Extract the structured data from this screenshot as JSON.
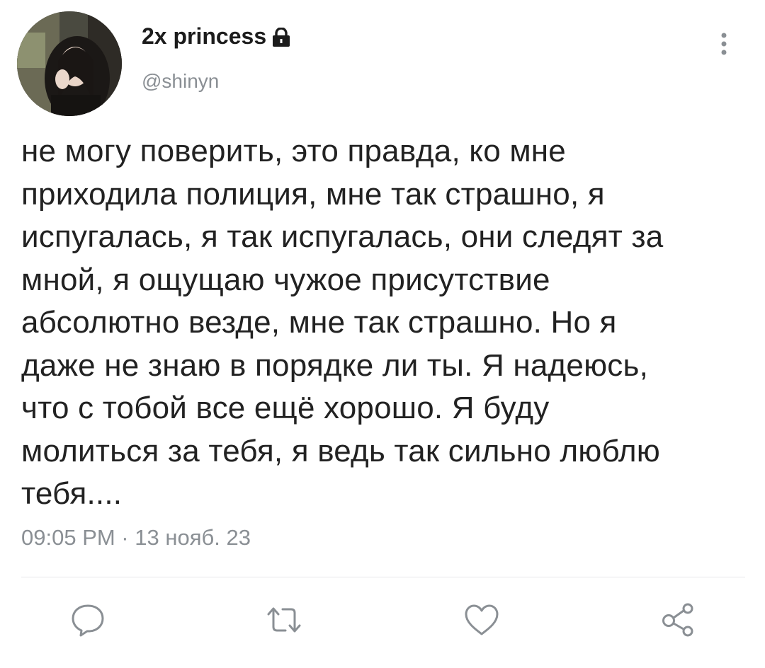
{
  "user": {
    "display_name": "2x princess",
    "handle": "@shinyn",
    "protected_icon": "lock-icon",
    "avatar": "profile-photo"
  },
  "tweet": {
    "text": "не могу поверить, это правда, ко мне\nприходила полиция, мне так страшно, я\nиспугалась, я так испугалась, они следят за\nмной, я ощущаю чужое присутствие\nабсолютно везде, мне так страшно. Но я\nдаже не знаю в порядке ли ты. Я надеюсь,\nчто с тобой все ещё хорошо. Я буду\nмолиться за тебя, я ведь так сильно люблю\nтебя....",
    "timestamp": "09:05 PM · 13 нояб. 23"
  },
  "actions": [
    "reply-icon",
    "retweet-icon",
    "like-icon",
    "share-icon"
  ],
  "colors": {
    "text": "#222222",
    "secondary": "#8a8f94",
    "icon": "#8a8f94",
    "divider": "#e6e8ea"
  }
}
